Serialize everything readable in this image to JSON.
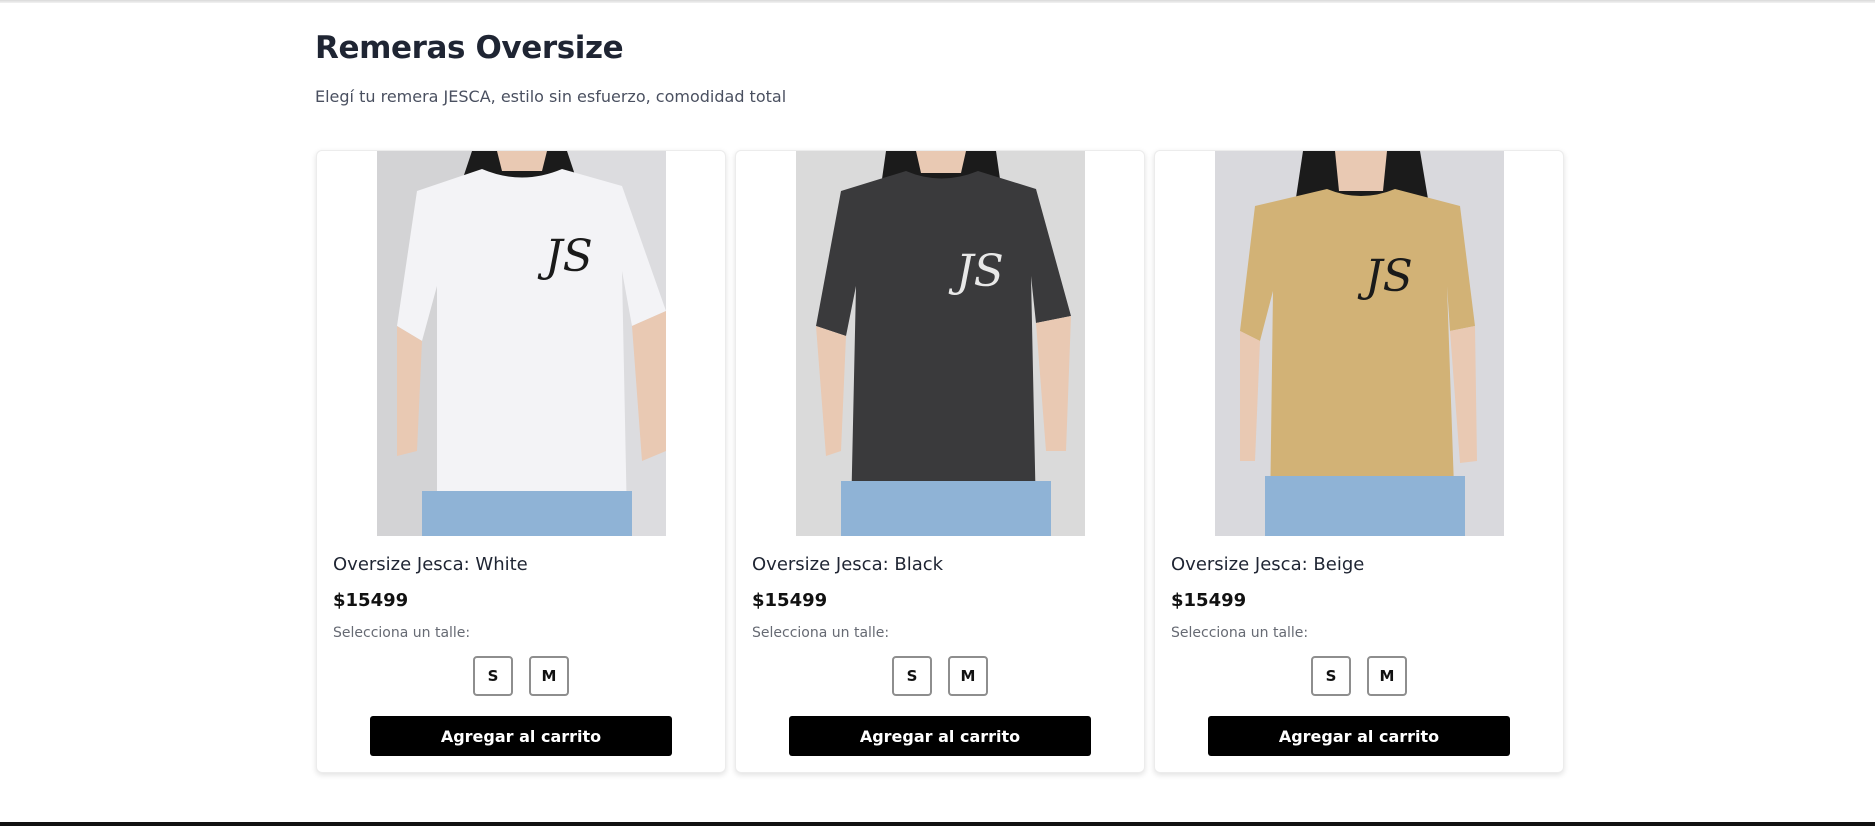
{
  "page": {
    "title": "Remeras Oversize",
    "subtitle": "Elegí tu remera JESCA, estilo sin esfuerzo, comodidad total"
  },
  "products": [
    {
      "name": "Oversize Jesca: White",
      "price": "$15499",
      "size_prompt": "Selecciona un talle:",
      "sizes": [
        "S",
        "M"
      ],
      "add_label": "Agregar al carrito",
      "shirt_color": "#f3f3f6",
      "logo_color": "#1a1a1a",
      "logo_text": "JS"
    },
    {
      "name": "Oversize Jesca: Black",
      "price": "$15499",
      "size_prompt": "Selecciona un talle:",
      "sizes": [
        "S",
        "M"
      ],
      "add_label": "Agregar al carrito",
      "shirt_color": "#3a3a3c",
      "logo_color": "#e8e8e8",
      "logo_text": "JS"
    },
    {
      "name": "Oversize Jesca: Beige",
      "price": "$15499",
      "size_prompt": "Selecciona un talle:",
      "sizes": [
        "S",
        "M"
      ],
      "add_label": "Agregar al carrito",
      "shirt_color": "#d2b276",
      "logo_color": "#1a1a1a",
      "logo_text": "JS"
    }
  ],
  "colors": {
    "title": "#1f2533",
    "button_bg": "#000000",
    "button_text": "#ffffff",
    "jeans": "#8fb3d6",
    "wall": "#d7d7db",
    "hair": "#1b1b1b",
    "skin": "#e9c9b3"
  }
}
